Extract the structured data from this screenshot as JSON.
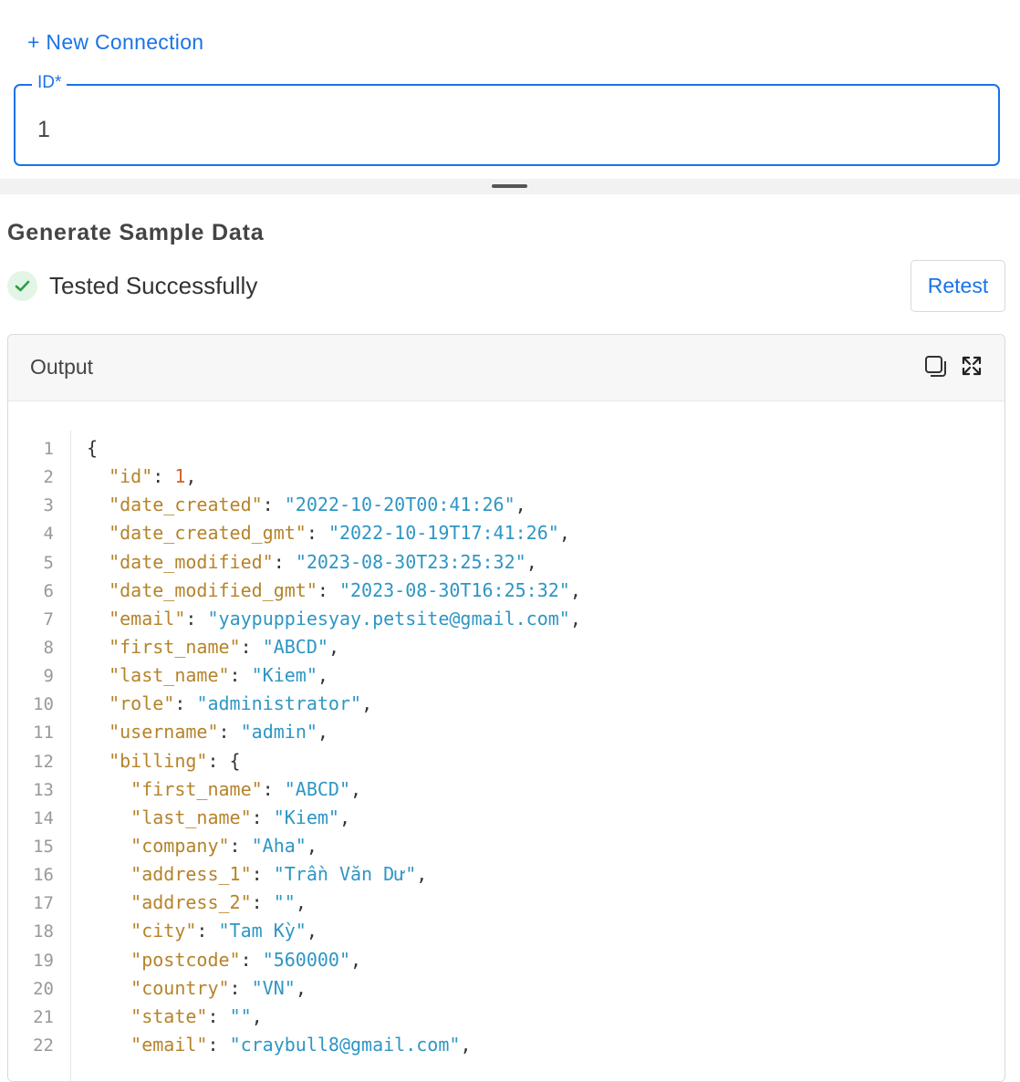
{
  "header": {
    "new_connection_label": "+ New Connection"
  },
  "id_field": {
    "label": "ID*",
    "value": "1"
  },
  "section": {
    "title": "Generate Sample Data"
  },
  "status": {
    "text": "Tested Successfully",
    "icon": "check-circle-icon",
    "color": "#2e9e46"
  },
  "retest_label": "Retest",
  "output": {
    "title": "Output",
    "icons": [
      "copy-icon",
      "expand-icon"
    ],
    "lines": [
      {
        "n": "1",
        "indent": 0,
        "tokens": [
          {
            "t": "p",
            "v": "{"
          }
        ]
      },
      {
        "n": "2",
        "indent": 1,
        "tokens": [
          {
            "t": "k",
            "v": "\"id\""
          },
          {
            "t": "p",
            "v": ": "
          },
          {
            "t": "n",
            "v": "1"
          },
          {
            "t": "p",
            "v": ","
          }
        ]
      },
      {
        "n": "3",
        "indent": 1,
        "tokens": [
          {
            "t": "k",
            "v": "\"date_created\""
          },
          {
            "t": "p",
            "v": ": "
          },
          {
            "t": "s",
            "v": "\"2022-10-20T00:41:26\""
          },
          {
            "t": "p",
            "v": ","
          }
        ]
      },
      {
        "n": "4",
        "indent": 1,
        "tokens": [
          {
            "t": "k",
            "v": "\"date_created_gmt\""
          },
          {
            "t": "p",
            "v": ": "
          },
          {
            "t": "s",
            "v": "\"2022-10-19T17:41:26\""
          },
          {
            "t": "p",
            "v": ","
          }
        ]
      },
      {
        "n": "5",
        "indent": 1,
        "tokens": [
          {
            "t": "k",
            "v": "\"date_modified\""
          },
          {
            "t": "p",
            "v": ": "
          },
          {
            "t": "s",
            "v": "\"2023-08-30T23:25:32\""
          },
          {
            "t": "p",
            "v": ","
          }
        ]
      },
      {
        "n": "6",
        "indent": 1,
        "tokens": [
          {
            "t": "k",
            "v": "\"date_modified_gmt\""
          },
          {
            "t": "p",
            "v": ": "
          },
          {
            "t": "s",
            "v": "\"2023-08-30T16:25:32\""
          },
          {
            "t": "p",
            "v": ","
          }
        ]
      },
      {
        "n": "7",
        "indent": 1,
        "tokens": [
          {
            "t": "k",
            "v": "\"email\""
          },
          {
            "t": "p",
            "v": ": "
          },
          {
            "t": "s",
            "v": "\"yaypuppiesyay.petsite@gmail.com\""
          },
          {
            "t": "p",
            "v": ","
          }
        ]
      },
      {
        "n": "8",
        "indent": 1,
        "tokens": [
          {
            "t": "k",
            "v": "\"first_name\""
          },
          {
            "t": "p",
            "v": ": "
          },
          {
            "t": "s",
            "v": "\"ABCD\""
          },
          {
            "t": "p",
            "v": ","
          }
        ]
      },
      {
        "n": "9",
        "indent": 1,
        "tokens": [
          {
            "t": "k",
            "v": "\"last_name\""
          },
          {
            "t": "p",
            "v": ": "
          },
          {
            "t": "s",
            "v": "\"Kiem\""
          },
          {
            "t": "p",
            "v": ","
          }
        ]
      },
      {
        "n": "10",
        "indent": 1,
        "tokens": [
          {
            "t": "k",
            "v": "\"role\""
          },
          {
            "t": "p",
            "v": ": "
          },
          {
            "t": "s",
            "v": "\"administrator\""
          },
          {
            "t": "p",
            "v": ","
          }
        ]
      },
      {
        "n": "11",
        "indent": 1,
        "tokens": [
          {
            "t": "k",
            "v": "\"username\""
          },
          {
            "t": "p",
            "v": ": "
          },
          {
            "t": "s",
            "v": "\"admin\""
          },
          {
            "t": "p",
            "v": ","
          }
        ]
      },
      {
        "n": "12",
        "indent": 1,
        "tokens": [
          {
            "t": "k",
            "v": "\"billing\""
          },
          {
            "t": "p",
            "v": ": {"
          }
        ]
      },
      {
        "n": "13",
        "indent": 2,
        "tokens": [
          {
            "t": "k",
            "v": "\"first_name\""
          },
          {
            "t": "p",
            "v": ": "
          },
          {
            "t": "s",
            "v": "\"ABCD\""
          },
          {
            "t": "p",
            "v": ","
          }
        ]
      },
      {
        "n": "14",
        "indent": 2,
        "tokens": [
          {
            "t": "k",
            "v": "\"last_name\""
          },
          {
            "t": "p",
            "v": ": "
          },
          {
            "t": "s",
            "v": "\"Kiem\""
          },
          {
            "t": "p",
            "v": ","
          }
        ]
      },
      {
        "n": "15",
        "indent": 2,
        "tokens": [
          {
            "t": "k",
            "v": "\"company\""
          },
          {
            "t": "p",
            "v": ": "
          },
          {
            "t": "s",
            "v": "\"Aha\""
          },
          {
            "t": "p",
            "v": ","
          }
        ]
      },
      {
        "n": "16",
        "indent": 2,
        "tokens": [
          {
            "t": "k",
            "v": "\"address_1\""
          },
          {
            "t": "p",
            "v": ": "
          },
          {
            "t": "s",
            "v": "\"Trần Văn Dư\""
          },
          {
            "t": "p",
            "v": ","
          }
        ]
      },
      {
        "n": "17",
        "indent": 2,
        "tokens": [
          {
            "t": "k",
            "v": "\"address_2\""
          },
          {
            "t": "p",
            "v": ": "
          },
          {
            "t": "s",
            "v": "\"\""
          },
          {
            "t": "p",
            "v": ","
          }
        ]
      },
      {
        "n": "18",
        "indent": 2,
        "tokens": [
          {
            "t": "k",
            "v": "\"city\""
          },
          {
            "t": "p",
            "v": ": "
          },
          {
            "t": "s",
            "v": "\"Tam Kỳ\""
          },
          {
            "t": "p",
            "v": ","
          }
        ]
      },
      {
        "n": "19",
        "indent": 2,
        "tokens": [
          {
            "t": "k",
            "v": "\"postcode\""
          },
          {
            "t": "p",
            "v": ": "
          },
          {
            "t": "s",
            "v": "\"560000\""
          },
          {
            "t": "p",
            "v": ","
          }
        ]
      },
      {
        "n": "20",
        "indent": 2,
        "tokens": [
          {
            "t": "k",
            "v": "\"country\""
          },
          {
            "t": "p",
            "v": ": "
          },
          {
            "t": "s",
            "v": "\"VN\""
          },
          {
            "t": "p",
            "v": ","
          }
        ]
      },
      {
        "n": "21",
        "indent": 2,
        "tokens": [
          {
            "t": "k",
            "v": "\"state\""
          },
          {
            "t": "p",
            "v": ": "
          },
          {
            "t": "s",
            "v": "\"\""
          },
          {
            "t": "p",
            "v": ","
          }
        ]
      },
      {
        "n": "22",
        "indent": 2,
        "tokens": [
          {
            "t": "k",
            "v": "\"email\""
          },
          {
            "t": "p",
            "v": ": "
          },
          {
            "t": "s",
            "v": "\"craybull8@gmail.com\""
          },
          {
            "t": "p",
            "v": ","
          }
        ]
      }
    ]
  },
  "colors": {
    "accent": "#1a73e8",
    "json_key": "#b5832a",
    "json_string": "#2e96c4",
    "json_number": "#d0612a"
  }
}
